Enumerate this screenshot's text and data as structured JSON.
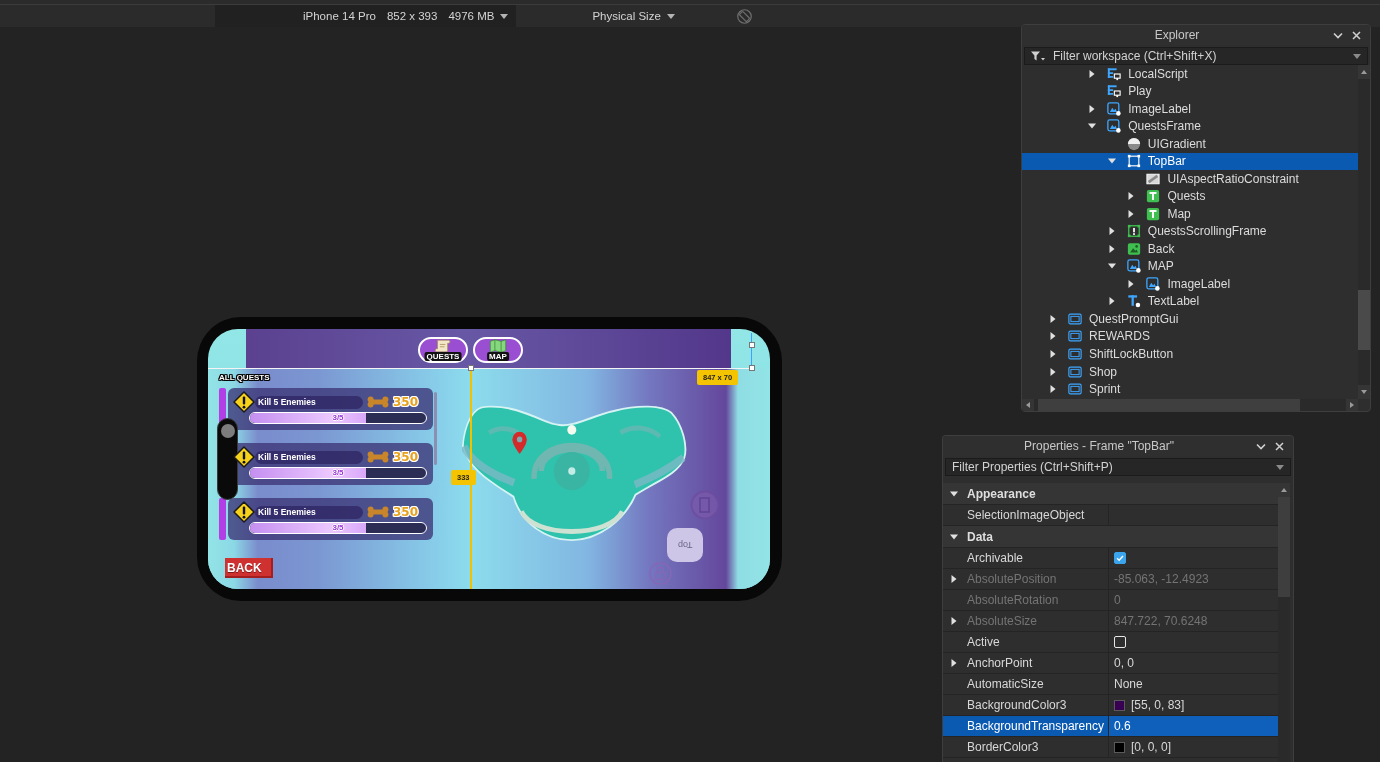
{
  "toolbar": {
    "device": "iPhone 14 Pro",
    "resolution": "852 x 393",
    "memory": "4976 MB",
    "scale": "Physical Size"
  },
  "viewport": {
    "game_ui": {
      "top_buttons": [
        {
          "label": "QUESTS",
          "kind": "scroll"
        },
        {
          "label": "MAP",
          "kind": "map"
        }
      ],
      "section_title": "ALL QUESTS",
      "quests": [
        {
          "title": "Kill 5 Enemies",
          "reward": "350",
          "progress": "3/5",
          "level": 0.66
        },
        {
          "title": "Kill 5 Enemies",
          "reward": "350",
          "progress": "3/5",
          "level": 0.66
        },
        {
          "title": "Kill 5 Enemies",
          "reward": "350",
          "progress": "3/5",
          "level": 0.66
        }
      ],
      "back_button": "BACK"
    },
    "view_cube": {
      "label": "Top"
    },
    "selection": {
      "size_tag": "847 x 70",
      "distance_tag": "333"
    }
  },
  "explorer": {
    "title": "Explorer",
    "filter": {
      "placeholder": "Filter workspace (Ctrl+Shift+X)"
    },
    "tree": [
      {
        "children": [
          {
            "children": [
              {
                "name": "LocalScript",
                "kind": "local-script",
                "expandable": true,
                "expanded": false,
                "selected": false
              },
              {
                "name": "Play",
                "kind": "local-script",
                "expandable": false,
                "expanded": false,
                "selected": false
              },
              {
                "name": "ImageLabel",
                "kind": "image-label",
                "expandable": true,
                "expanded": false,
                "selected": false
              },
              {
                "name": "QuestsFrame",
                "kind": "image-label",
                "expandable": true,
                "expanded": true,
                "selected": false,
                "children": [
                  {
                    "name": "UIGradient",
                    "kind": "gradient",
                    "expandable": false,
                    "expanded": false,
                    "selected": false
                  },
                  {
                    "name": "TopBar",
                    "kind": "frame",
                    "expandable": true,
                    "expanded": true,
                    "selected": true,
                    "children": [
                      {
                        "name": "UIAspectRatioConstraint",
                        "kind": "aspect-ratio",
                        "expandable": false,
                        "expanded": false,
                        "selected": false
                      },
                      {
                        "name": "Quests",
                        "kind": "text-button",
                        "expandable": true,
                        "expanded": false,
                        "selected": false
                      },
                      {
                        "name": "Map",
                        "kind": "text-button",
                        "expandable": true,
                        "expanded": false,
                        "selected": false
                      }
                    ]
                  },
                  {
                    "name": "QuestsScrollingFrame",
                    "kind": "scrolling-frame",
                    "expandable": true,
                    "expanded": false,
                    "selected": false
                  },
                  {
                    "name": "Back",
                    "kind": "image-button",
                    "expandable": true,
                    "expanded": false,
                    "selected": false
                  },
                  {
                    "name": "MAP",
                    "kind": "image-label",
                    "expandable": true,
                    "expanded": true,
                    "selected": false,
                    "children": [
                      {
                        "name": "ImageLabel",
                        "kind": "image-label",
                        "expandable": true,
                        "expanded": false,
                        "selected": false
                      }
                    ]
                  },
                  {
                    "name": "TextLabel",
                    "kind": "text-label",
                    "expandable": true,
                    "expanded": false,
                    "selected": false
                  }
                ]
              }
            ]
          }
        ]
      },
      {
        "name": "QuestPromptGui",
        "kind": "screen-gui",
        "expandable": true,
        "expanded": false,
        "selected": false
      },
      {
        "name": "REWARDS",
        "kind": "screen-gui",
        "expandable": true,
        "expanded": false,
        "selected": false
      },
      {
        "name": "ShiftLockButton",
        "kind": "screen-gui",
        "expandable": true,
        "expanded": false,
        "selected": false
      },
      {
        "name": "Shop",
        "kind": "screen-gui",
        "expandable": true,
        "expanded": false,
        "selected": false
      },
      {
        "name": "Sprint",
        "kind": "screen-gui",
        "expandable": true,
        "expanded": false,
        "selected": false
      }
    ]
  },
  "properties": {
    "title": "Properties - Frame \"TopBar\"",
    "filter": {
      "placeholder": "Filter Properties (Ctrl+Shift+P)"
    },
    "sections": [
      {
        "title": "Appearance",
        "expanded": true,
        "rows": [
          {
            "name": "SelectionImageObject",
            "kind": "text",
            "expandable": false,
            "disabled": false,
            "selected": false
          }
        ]
      },
      {
        "title": "Data",
        "expanded": true,
        "rows": [
          {
            "name": "Archivable",
            "kind": "checkbox",
            "checked": true,
            "expandable": false,
            "disabled": false,
            "selected": false
          },
          {
            "name": "AbsolutePosition",
            "kind": "text",
            "value": "-85.063, -12.4923",
            "expandable": true,
            "disabled": true,
            "selected": false
          },
          {
            "name": "AbsoluteRotation",
            "kind": "text",
            "value": "0",
            "expandable": false,
            "disabled": true,
            "selected": false
          },
          {
            "name": "AbsoluteSize",
            "kind": "text",
            "value": "847.722, 70.6248",
            "expandable": true,
            "disabled": true,
            "selected": false
          },
          {
            "name": "Active",
            "kind": "checkbox",
            "checked": false,
            "expandable": false,
            "disabled": false,
            "selected": false
          },
          {
            "name": "AnchorPoint",
            "kind": "text",
            "value": "0, 0",
            "expandable": true,
            "disabled": false,
            "selected": false
          },
          {
            "name": "AutomaticSize",
            "kind": "text",
            "value": "None",
            "expandable": false,
            "disabled": false,
            "selected": false
          },
          {
            "name": "BackgroundColor3",
            "kind": "color",
            "color": "#370053",
            "value": "[55, 0, 83]",
            "expandable": false,
            "disabled": false,
            "selected": false
          },
          {
            "name": "BackgroundTransparency",
            "kind": "text",
            "value": "0.6",
            "expandable": false,
            "disabled": false,
            "selected": true
          },
          {
            "name": "BorderColor3",
            "kind": "color",
            "color": "#000000",
            "value": "[0, 0, 0]",
            "expandable": false,
            "disabled": false,
            "selected": false
          }
        ]
      }
    ]
  }
}
